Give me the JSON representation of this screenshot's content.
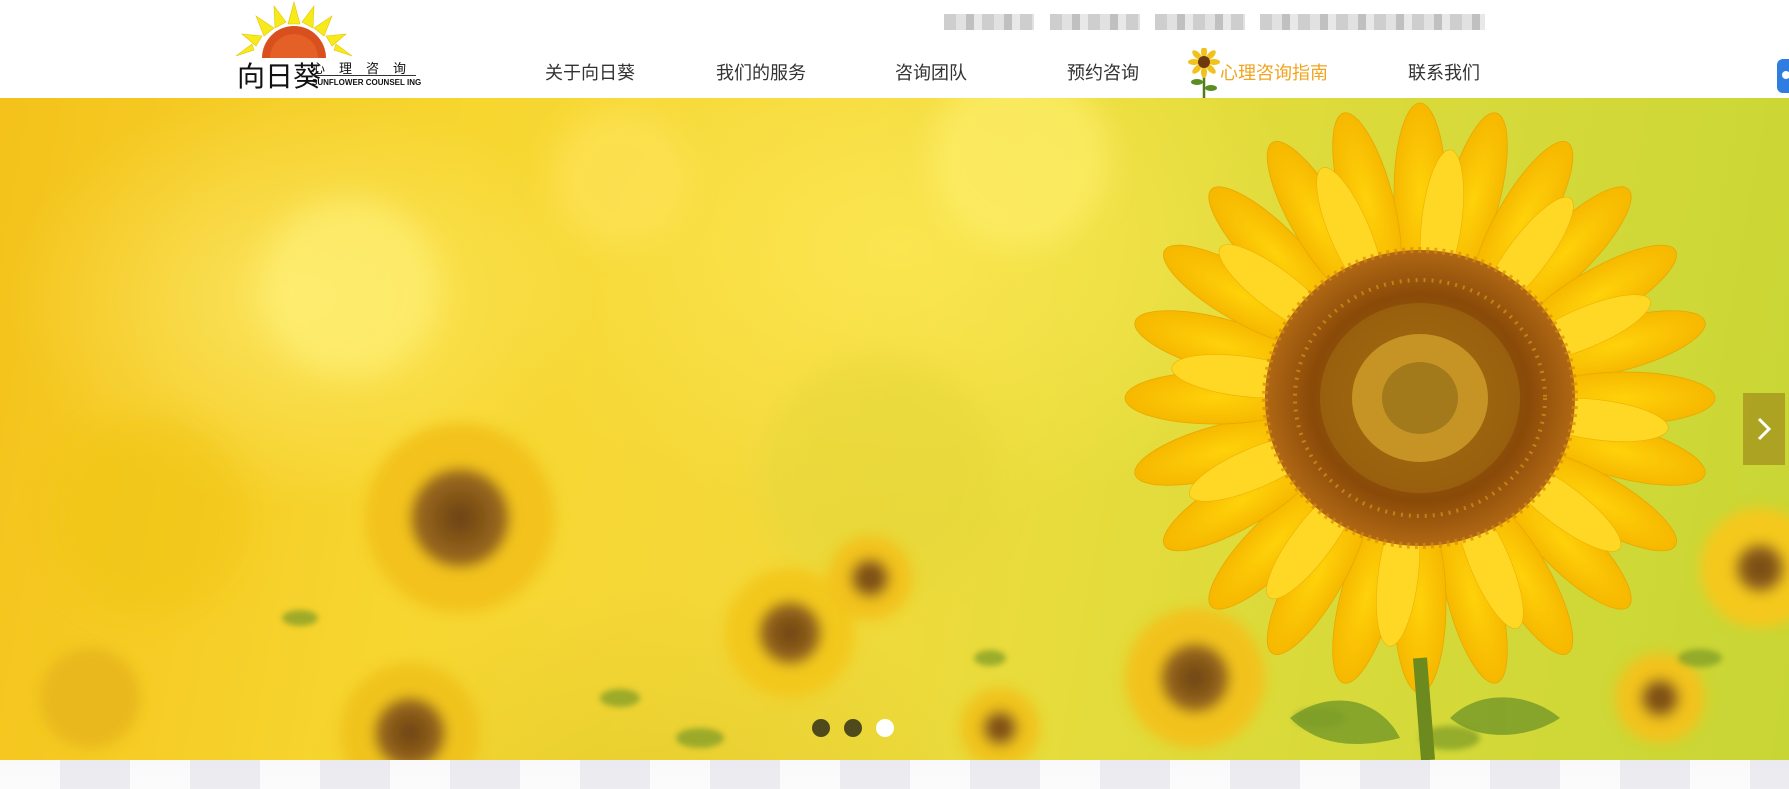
{
  "logo": {
    "main_text": "向日葵",
    "sub_text": "心理咨询",
    "en_text": "SUNFLOWER COUNSEL ING"
  },
  "top_links": [
    "",
    "",
    "",
    ""
  ],
  "nav": {
    "items": [
      {
        "label": "关于向日葵",
        "active": false
      },
      {
        "label": "我们的服务",
        "active": false
      },
      {
        "label": "咨询团队",
        "active": false
      },
      {
        "label": "预约咨询",
        "active": false
      },
      {
        "label": "心理咨询指南",
        "active": true
      },
      {
        "label": "联系我们",
        "active": false
      }
    ]
  },
  "banner": {
    "slide_count": 3,
    "active_slide": 3
  },
  "colors": {
    "accent": "#f0a520",
    "nav_text": "#333333",
    "side_tab": "#2f7de1"
  },
  "icons": {
    "next_arrow": "chevron-right-icon",
    "nav_decoration": "sunflower-icon",
    "side_tab": "chat-icon"
  }
}
